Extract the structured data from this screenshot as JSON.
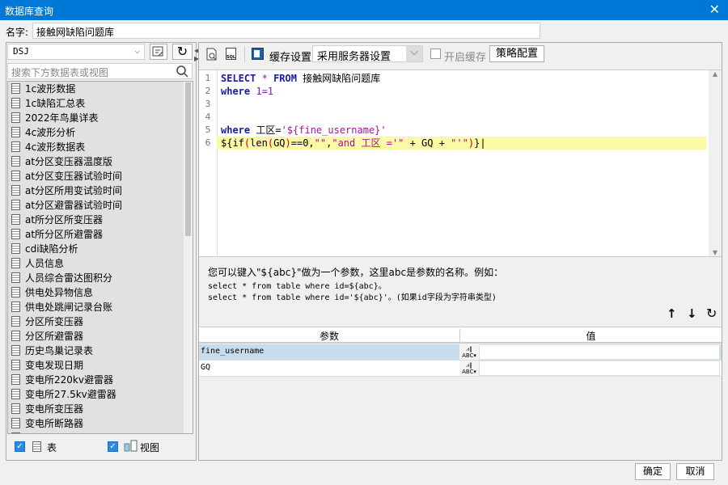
{
  "window": {
    "title": "数据库查询",
    "close_icon": "close-icon"
  },
  "name_row": {
    "label": "名字:",
    "value": "接触网缺陷问题库"
  },
  "left": {
    "connection": "DSJ",
    "search_placeholder": "搜索下方数据表或视图",
    "items": [
      "1c波形数据",
      "1c缺陷汇总表",
      "2022年鸟巢详表",
      "4c波形分析",
      "4c波形数据表",
      "at分区变压器温度版",
      "at分区变压器试验时间",
      "at分区所用变试验时间",
      "at分区避雷器试验时间",
      "at所分区所变压器",
      "at所分区所避雷器",
      "cdi缺陷分析",
      "人员信息",
      "人员综合雷达图积分",
      "供电处异物信息",
      "供电处跳闸记录台账",
      "分区所变压器",
      "分区所避雷器",
      "历史鸟巢记录表",
      "变电发现日期",
      "变电所220kv避雷器",
      "变电所27.5kv避雷器",
      "变电所变压器",
      "变电所断路器",
      ""
    ],
    "show_tables": {
      "label": "表",
      "checked": true
    },
    "show_views": {
      "label": "视图",
      "checked": true
    }
  },
  "toolbar": {
    "cache_settings": "缓存设置",
    "cache_mode": "采用服务器设置",
    "enable_cache": {
      "label": "开启缓存",
      "checked": false
    },
    "strategy": "策略配置"
  },
  "editor": {
    "line_numbers": [
      "1",
      "2",
      "3",
      "4",
      "5",
      "6"
    ]
  },
  "help": {
    "line1": "您可以键入\"${abc}\"做为一个参数，这里abc是参数的名称。例如：",
    "line2": "select * from table where id=${abc}。",
    "line3": "select * from table where id='${abc}'。(如果id字段为字符串类型)"
  },
  "params": {
    "col_param": "参数",
    "col_value": "值",
    "rows": [
      {
        "name": "fine_username",
        "value": "",
        "selected": true
      },
      {
        "name": "GQ",
        "value": "",
        "selected": false
      }
    ]
  },
  "footer": {
    "ok": "确定",
    "cancel": "取消"
  }
}
